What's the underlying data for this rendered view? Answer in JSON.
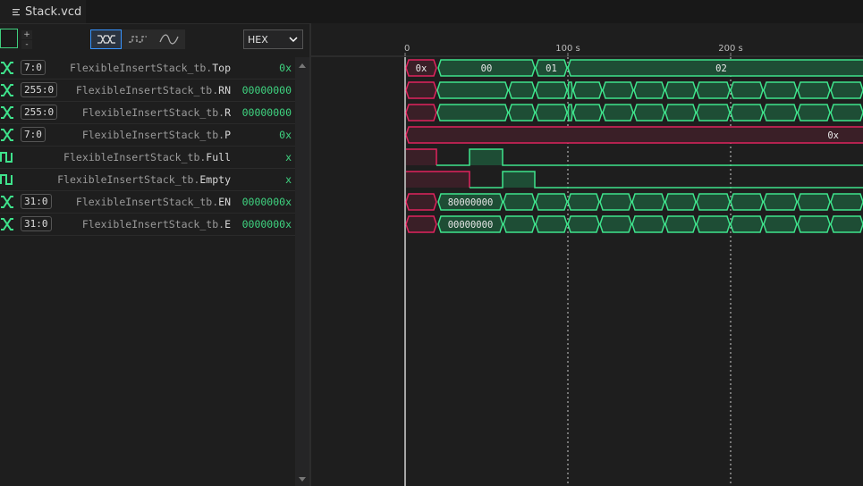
{
  "tab": {
    "title": "Stack.vcd"
  },
  "toolbar": {
    "plus": "+",
    "minus": "-",
    "radix": "HEX"
  },
  "timeline": {
    "ticks": [
      "0",
      "100 s",
      "200 s"
    ]
  },
  "signals": [
    {
      "width": "7:0",
      "prefix": "FlexibleInsertStack_tb.",
      "name": "Top",
      "value": "0x",
      "kind": "bus"
    },
    {
      "width": "255:0",
      "prefix": "FlexibleInsertStack_tb.",
      "name": "RN",
      "value": "00000000",
      "kind": "bus"
    },
    {
      "width": "255:0",
      "prefix": "FlexibleInsertStack_tb.",
      "name": "R",
      "value": "00000000",
      "kind": "bus"
    },
    {
      "width": "7:0",
      "prefix": "FlexibleInsertStack_tb.",
      "name": "P",
      "value": "0x",
      "kind": "bus"
    },
    {
      "width": "",
      "prefix": "FlexibleInsertStack_tb.",
      "name": "Full",
      "value": "x",
      "kind": "bit"
    },
    {
      "width": "",
      "prefix": "FlexibleInsertStack_tb.",
      "name": "Empty",
      "value": "x",
      "kind": "bit"
    },
    {
      "width": "31:0",
      "prefix": "FlexibleInsertStack_tb.",
      "name": "EN",
      "value": "0000000x",
      "kind": "bus"
    },
    {
      "width": "31:0",
      "prefix": "FlexibleInsertStack_tb.",
      "name": "E",
      "value": "0000000x",
      "kind": "bus"
    }
  ],
  "wave_labels": {
    "top": [
      "0x",
      "00",
      "01",
      "02"
    ],
    "p": [
      "0x"
    ],
    "en": [
      "80000000"
    ],
    "e": [
      "00000000"
    ]
  },
  "colors": {
    "valid": "#3fe38c",
    "valid_fill": "#1e4d35",
    "unknown": "#e0245e",
    "unknown_fill": "#3a1f27",
    "cursor": "#ffffff"
  }
}
